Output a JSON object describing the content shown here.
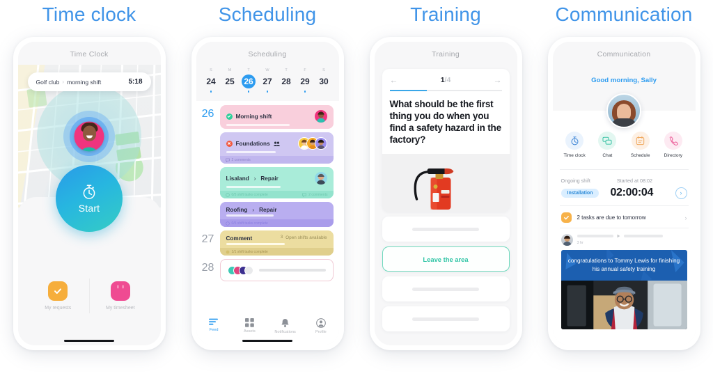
{
  "headings": [
    {
      "label": "Time clock"
    },
    {
      "label": "Scheduling"
    },
    {
      "label": "Training"
    },
    {
      "label": "Communication"
    }
  ],
  "accent": {
    "heading_blue": "#4094e8",
    "primary_blue": "#2d9cf0",
    "green": "#2ec4a5",
    "orange": "#f7b24a",
    "pink": "#ef4b92",
    "banner_blue": "#1c5fb0"
  },
  "time_clock": {
    "nav_title": "Time Clock",
    "shift_bar": {
      "location": "Golf club",
      "separator": "›",
      "shift": "morning shift",
      "elapsed": "5:18"
    },
    "start_button": {
      "label": "Start",
      "icon": "stopwatch-icon"
    },
    "tiles": [
      {
        "label": "My requests",
        "icon": "check-icon",
        "color": "#f6ae3c"
      },
      {
        "label": "My timesheet",
        "icon": "calendar-icon",
        "color": "#ef4b92"
      }
    ]
  },
  "scheduling": {
    "nav_title": "Scheduling",
    "week": [
      {
        "dow": "S",
        "num": "24",
        "active": false,
        "dot": true
      },
      {
        "dow": "M",
        "num": "25",
        "active": false,
        "dot": false
      },
      {
        "dow": "T",
        "num": "26",
        "active": true,
        "dot": true
      },
      {
        "dow": "W",
        "num": "27",
        "active": false,
        "dot": true
      },
      {
        "dow": "T",
        "num": "28",
        "active": false,
        "dot": false
      },
      {
        "dow": "F",
        "num": "29",
        "active": false,
        "dot": true
      },
      {
        "dow": "S",
        "num": "30",
        "active": false,
        "dot": false
      }
    ],
    "rows": [
      {
        "date": "26",
        "cards": [
          {
            "title": "Morning shift",
            "status": "complete",
            "footer": ""
          },
          {
            "title": "Foundations",
            "status": "incomplete",
            "footer": "2 comments",
            "group_icon": "people-icon"
          },
          {
            "title": "Lisaland",
            "subtitle": "Repair",
            "footer": "0/5 shift tasks complete",
            "footer2": "2 comments"
          },
          {
            "title": "Roofing",
            "subtitle": "Repair",
            "footer": "0/5 shift tasks complete"
          }
        ]
      },
      {
        "date": "27",
        "cards": [
          {
            "title": "Comment",
            "open_count": "3",
            "open_label": "Open shifts available",
            "footer": "1/1 shift tasks complete"
          }
        ]
      },
      {
        "date": "28",
        "cards": [
          {
            "title": "",
            "placeholder": true
          }
        ]
      }
    ],
    "tabbar": [
      {
        "label": "Feed",
        "icon": "feed-icon",
        "active": true
      },
      {
        "label": "Assets",
        "icon": "grid-icon",
        "active": false
      },
      {
        "label": "Notifications",
        "icon": "bell-icon",
        "active": false
      },
      {
        "label": "Profile",
        "icon": "person-icon",
        "active": false
      }
    ]
  },
  "training": {
    "nav_title": "Training",
    "counter_current": "1",
    "counter_total": "/4",
    "back_icon": "arrow-left-icon",
    "next_icon": "arrow-right-icon",
    "question": "What should be the first thing you do when you find a safety hazard in the factory?",
    "image_alt": "fire-extinguisher-photo",
    "options": [
      {
        "label": "",
        "state": "blank"
      },
      {
        "label": "Leave the area",
        "state": "correct"
      },
      {
        "label": "",
        "state": "blank"
      },
      {
        "label": "",
        "state": "blank"
      }
    ]
  },
  "communication": {
    "nav_title": "Communication",
    "greeting": "Good morning, Sally",
    "avatar_alt": "user-avatar-sally",
    "quick_actions": [
      {
        "label": "Time clock",
        "icon": "stopwatch-icon",
        "color": "#eaf3fd",
        "stroke": "#3f86d6"
      },
      {
        "label": "Chat",
        "icon": "chat-icon",
        "color": "#e3f7f1",
        "stroke": "#3cc3a6"
      },
      {
        "label": "Schedule",
        "icon": "calendar-icon",
        "color": "#fdf0e4",
        "stroke": "#f0a95f"
      },
      {
        "label": "Directory",
        "icon": "phone-icon",
        "color": "#fdeaf2",
        "stroke": "#ec5f9a"
      }
    ],
    "shift": {
      "ongoing_label": "Ongoing shift",
      "started_label": "Started at 08:02",
      "pill": "Installation",
      "timer": "02:00:04",
      "chevron_icon": "chevron-right-icon"
    },
    "task": {
      "text": "2 tasks are due to tomorrow",
      "icon": "check-icon",
      "chevron_icon": "chevron-right-icon"
    },
    "post": {
      "time": "3 hr",
      "banner_text": "congratulations to Tommy Lewis for finishing his annual safety training",
      "photo_alt": "smiling-worker-photo"
    }
  }
}
